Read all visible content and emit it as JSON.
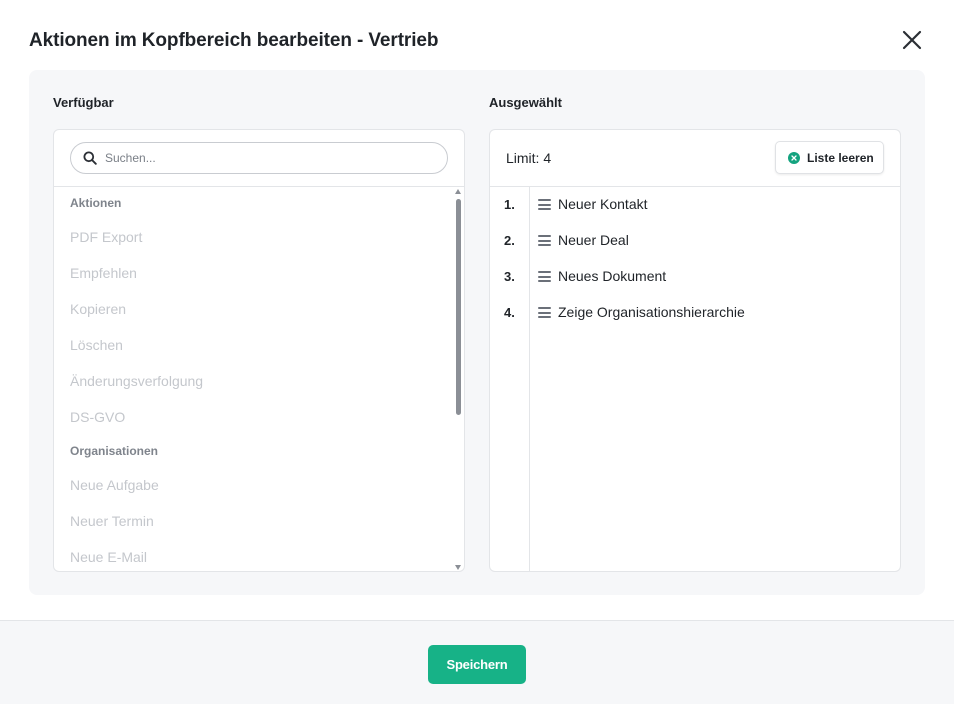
{
  "dialog": {
    "title": "Aktionen im Kopfbereich bearbeiten - Vertrieb",
    "close_icon": "close-icon"
  },
  "available": {
    "label": "Verfügbar",
    "search_placeholder": "Suchen...",
    "groups": [
      {
        "name": "Aktionen",
        "items": [
          "PDF Export",
          "Empfehlen",
          "Kopieren",
          "Löschen",
          "Änderungsverfolgung",
          "DS-GVO"
        ]
      },
      {
        "name": "Organisationen",
        "items": [
          "Neue Aufgabe",
          "Neuer Termin",
          "Neue E-Mail"
        ]
      }
    ]
  },
  "selected": {
    "label": "Ausgewählt",
    "limit_text": "Limit: 4",
    "clear_label": "Liste leeren",
    "items": [
      {
        "num": "1.",
        "label": "Neuer Kontakt"
      },
      {
        "num": "2.",
        "label": "Neuer Deal"
      },
      {
        "num": "3.",
        "label": "Neues Dokument"
      },
      {
        "num": "4.",
        "label": "Zeige Organisationshierarchie"
      }
    ]
  },
  "footer": {
    "save_label": "Speichern"
  },
  "colors": {
    "accent": "#17b287",
    "clear_icon": "#14a37f",
    "disabled_text": "#c4c7cc",
    "panel_bg": "#f6f7f9"
  }
}
